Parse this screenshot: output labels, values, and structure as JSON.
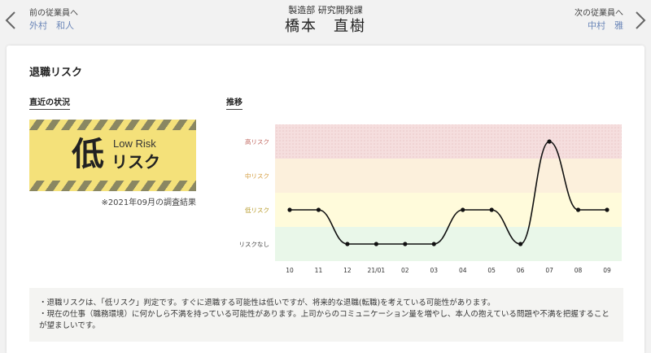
{
  "header": {
    "prev_caption": "前の従業員へ",
    "prev_name": "外村　和人",
    "department": "製造部 研究開発課",
    "employee_name": "橋本　直樹",
    "next_caption": "次の従業員へ",
    "next_name": "中村　雅"
  },
  "card": {
    "title": "退職リスク",
    "recent_label": "直近の状況",
    "trend_label": "推移",
    "badge": {
      "big_char": "低",
      "english": "Low Risk",
      "japanese": "リスク"
    },
    "survey_note": "※2021年09月の調査結果"
  },
  "chart_data": {
    "type": "line",
    "categories": [
      "10",
      "11",
      "12",
      "21/01",
      "02",
      "03",
      "04",
      "05",
      "06",
      "07",
      "08",
      "09"
    ],
    "levels": [
      "リスクなし",
      "低リスク",
      "中リスク",
      "高リスク"
    ],
    "values": [
      1,
      1,
      0,
      0,
      0,
      0,
      1,
      1,
      0,
      3,
      1,
      1
    ],
    "band_colors": [
      "#e9f7e9",
      "#fffbdb",
      "#fcf0dc",
      "#f5dede"
    ],
    "level_label_colors": [
      "#444444",
      "#b79a28",
      "#d39a3a",
      "#c0665e"
    ],
    "line_color": "#111111"
  },
  "notes": [
    "・退職リスクは、「低リスク」判定です。すぐに退職する可能性は低いですが、将来的な退職(転職)を考えている可能性があります。",
    "・現在の仕事（職務環境）に何かしら不満を持っている可能性があります。上司からのコミュニケーション量を増やし、本人の抱えている問題や不満を把握することが望ましいです。"
  ]
}
